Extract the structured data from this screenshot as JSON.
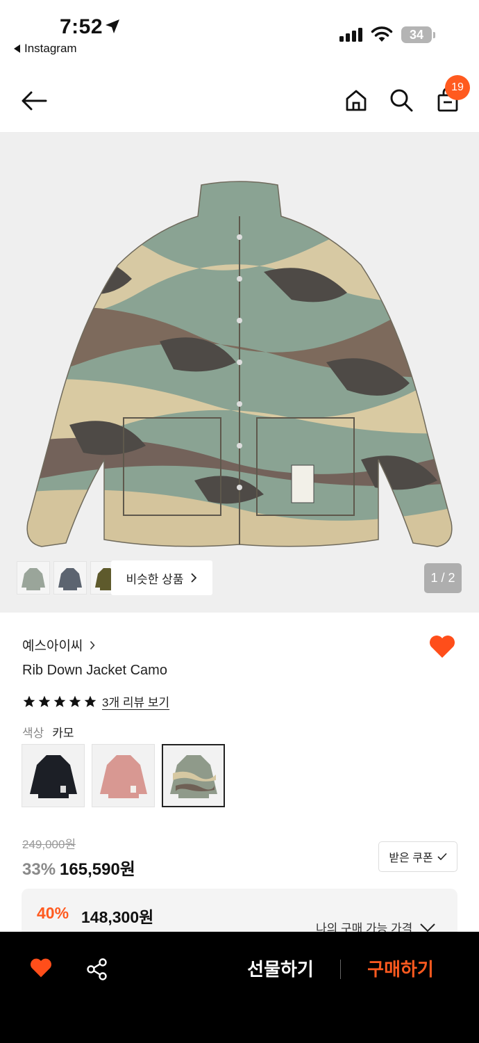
{
  "status_bar": {
    "time": "7:52",
    "back_app_label": "Instagram",
    "battery_level": "34"
  },
  "header": {
    "cart_count": "19",
    "icons": [
      "back-arrow-icon",
      "home-icon",
      "search-icon",
      "shopping-bag-icon"
    ]
  },
  "gallery": {
    "similar_button_label": "비슷한 상품",
    "page_indicator": "1 / 2",
    "thumbnail_colors": [
      "#9aa59a",
      "#5c6470",
      "#5e5a2c"
    ]
  },
  "product": {
    "brand": "예스아이씨",
    "title": "Rib Down Jacket Camo",
    "rating_stars": 5,
    "review_link": "3개 리뷰 보기",
    "color_label": "색상",
    "color_value": "카모",
    "color_options": [
      {
        "name": "black",
        "hex": "#1c1f26"
      },
      {
        "name": "pink",
        "hex": "#d89892"
      },
      {
        "name": "camo",
        "hex": "#8f8e78"
      }
    ],
    "selected_color_index": 2
  },
  "pricing": {
    "original_price": "249,000원",
    "discount_rate": "33%",
    "sale_price": "165,590원",
    "coupon_button_label": "받은 쿠폰",
    "my_discount_rate": "40%",
    "my_price": "148,300원",
    "my_price_label": "나의 구매 가능 가격"
  },
  "bottom_bar": {
    "gift_label": "선물하기",
    "buy_label": "구매하기"
  },
  "colors": {
    "accent": "#ff5a1f",
    "heart": "#ff4e1a"
  }
}
